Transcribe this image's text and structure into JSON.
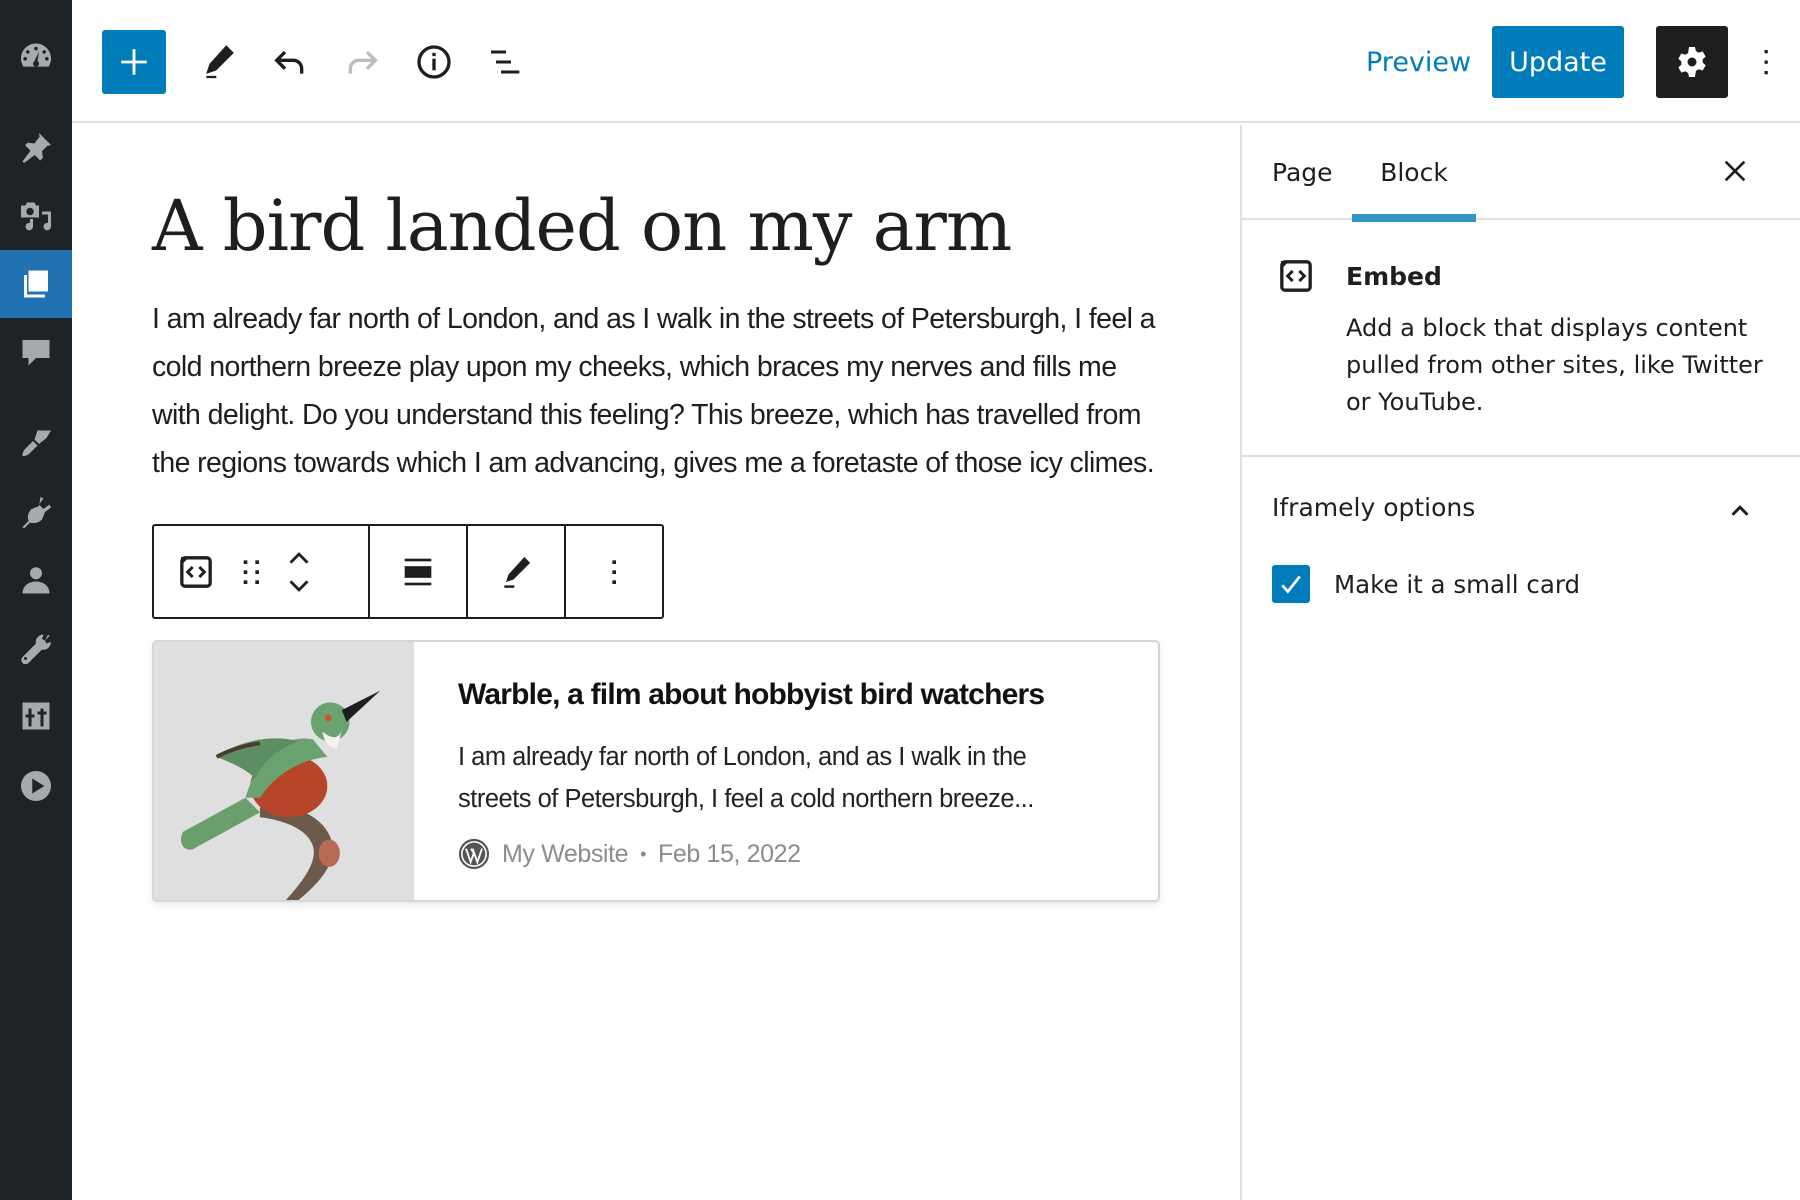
{
  "admin_menu": {
    "items": [
      {
        "name": "dashboard",
        "icon": "dashboard-icon",
        "active": false
      },
      {
        "name": "posts",
        "icon": "pin-icon",
        "active": false
      },
      {
        "name": "media",
        "icon": "media-icon",
        "active": false
      },
      {
        "name": "pages",
        "icon": "pages-icon",
        "active": true
      },
      {
        "name": "comments",
        "icon": "comment-icon",
        "active": false
      },
      {
        "name": "appearance",
        "icon": "brush-icon",
        "active": false
      },
      {
        "name": "plugins",
        "icon": "plugin-icon",
        "active": false
      },
      {
        "name": "users",
        "icon": "user-icon",
        "active": false
      },
      {
        "name": "tools",
        "icon": "wrench-icon",
        "active": false
      },
      {
        "name": "settings",
        "icon": "sliders-icon",
        "active": false
      },
      {
        "name": "collapse",
        "icon": "play-icon",
        "active": false
      }
    ]
  },
  "header": {
    "inserter_icon": "plus-icon",
    "tools": [
      "pencil-icon",
      "undo-icon",
      "redo-icon",
      "info-icon",
      "list-view-icon"
    ],
    "preview_label": "Preview",
    "update_label": "Update",
    "settings_icon": "gear-icon",
    "more_icon": "more-vertical-icon"
  },
  "editor": {
    "title": "A bird landed on my arm",
    "paragraph": "I am already far north of London, and as I walk in the streets of Petersburgh, I feel a cold northern breeze play upon my cheeks, which braces my nerves and fills me with delight. Do you understand this feeling? This breeze, which has travelled from the regions towards which I am advancing, gives me a foretaste of those icy climes.",
    "block_toolbar": {
      "buttons": [
        "embed-block-icon",
        "drag-handle-icon",
        "move-up-icon",
        "move-down-icon",
        "align-icon",
        "edit-url-icon",
        "more-options-icon"
      ]
    },
    "embed_card": {
      "title": "Warble, a film about hobbyist bird watchers",
      "description": "I am already far north of London, and as I walk in the streets of Petersburgh, I feel a cold northern breeze...",
      "site_name": "My Website",
      "separator": "•",
      "date": "Feb 15, 2022"
    }
  },
  "settings_panel": {
    "tabs": [
      {
        "label": "Page",
        "active": false
      },
      {
        "label": "Block",
        "active": true
      }
    ],
    "block_card": {
      "title": "Embed",
      "description": "Add a block that displays content pulled from other sites, like Twitter or YouTube."
    },
    "iframely": {
      "title": "Iframely options",
      "expanded": true,
      "small_card_label": "Make it a small card",
      "small_card_checked": true
    }
  },
  "colors": {
    "accent": "#007cba",
    "admin_bg": "#1d2327",
    "admin_active": "#2271b1",
    "tab_indicator": "#3595c8"
  }
}
